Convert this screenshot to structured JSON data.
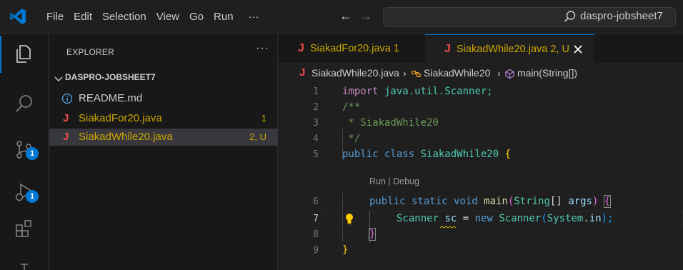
{
  "menu": [
    "File",
    "Edit",
    "Selection",
    "View",
    "Go",
    "Run",
    "···"
  ],
  "search": {
    "text": "daspro-jobsheet7"
  },
  "activity": {
    "scm_badge": "1",
    "debug_badge": "1"
  },
  "explorer": {
    "title": "EXPLORER",
    "more": "···",
    "folder": "DASPRO-JOBSHEET7",
    "files": [
      {
        "name": "README.md",
        "badge": "",
        "color": "#cccccc"
      },
      {
        "name": "SiakadFor20.java",
        "badge": "1",
        "color": "#cca700"
      },
      {
        "name": "SiakadWhile20.java",
        "badge": "2, U",
        "color": "#cca700"
      }
    ]
  },
  "tabs": [
    {
      "label": "SiakadFor20.java 1"
    },
    {
      "label": "SiakadWhile20.java 2, U"
    }
  ],
  "file_icon_letter": "J",
  "breadcrumbs": [
    "SiakadWhile20.java",
    "SiakadWhile20",
    "main(String[])"
  ],
  "codelens": "Run | Debug",
  "line_numbers": [
    "1",
    "2",
    "3",
    "4",
    "5",
    "6",
    "7",
    "8",
    "9"
  ],
  "code": {
    "l1": {
      "import": "import",
      "rest": " java.util.Scanner;"
    },
    "l2": "/**",
    "l3": " * SiakadWhile20",
    "l4": " */",
    "l5": {
      "kw1": "public",
      "kw2": " class",
      "name": " SiakadWhile20",
      "brace": " {"
    },
    "l6": {
      "kw1": "public",
      "kw2": " static",
      "kw3": " void",
      "fn": " main",
      "p1": "(",
      "ty": "String",
      "p2": "[] ",
      "va": "args",
      "p3": ") ",
      "brace": "{"
    },
    "l7": {
      "ty": "Scanner",
      "va": " sc",
      "op": " = ",
      "kw": "new",
      "ty2": " Scanner",
      "p1": "(",
      "ty3": "System",
      "dot": ".",
      "va2": "in",
      "p2": ");"
    },
    "l8": "}",
    "l9": "}"
  },
  "colors": {
    "accent": "#0078d4",
    "java_icon": "#f14c4c",
    "modified": "#cca700"
  }
}
